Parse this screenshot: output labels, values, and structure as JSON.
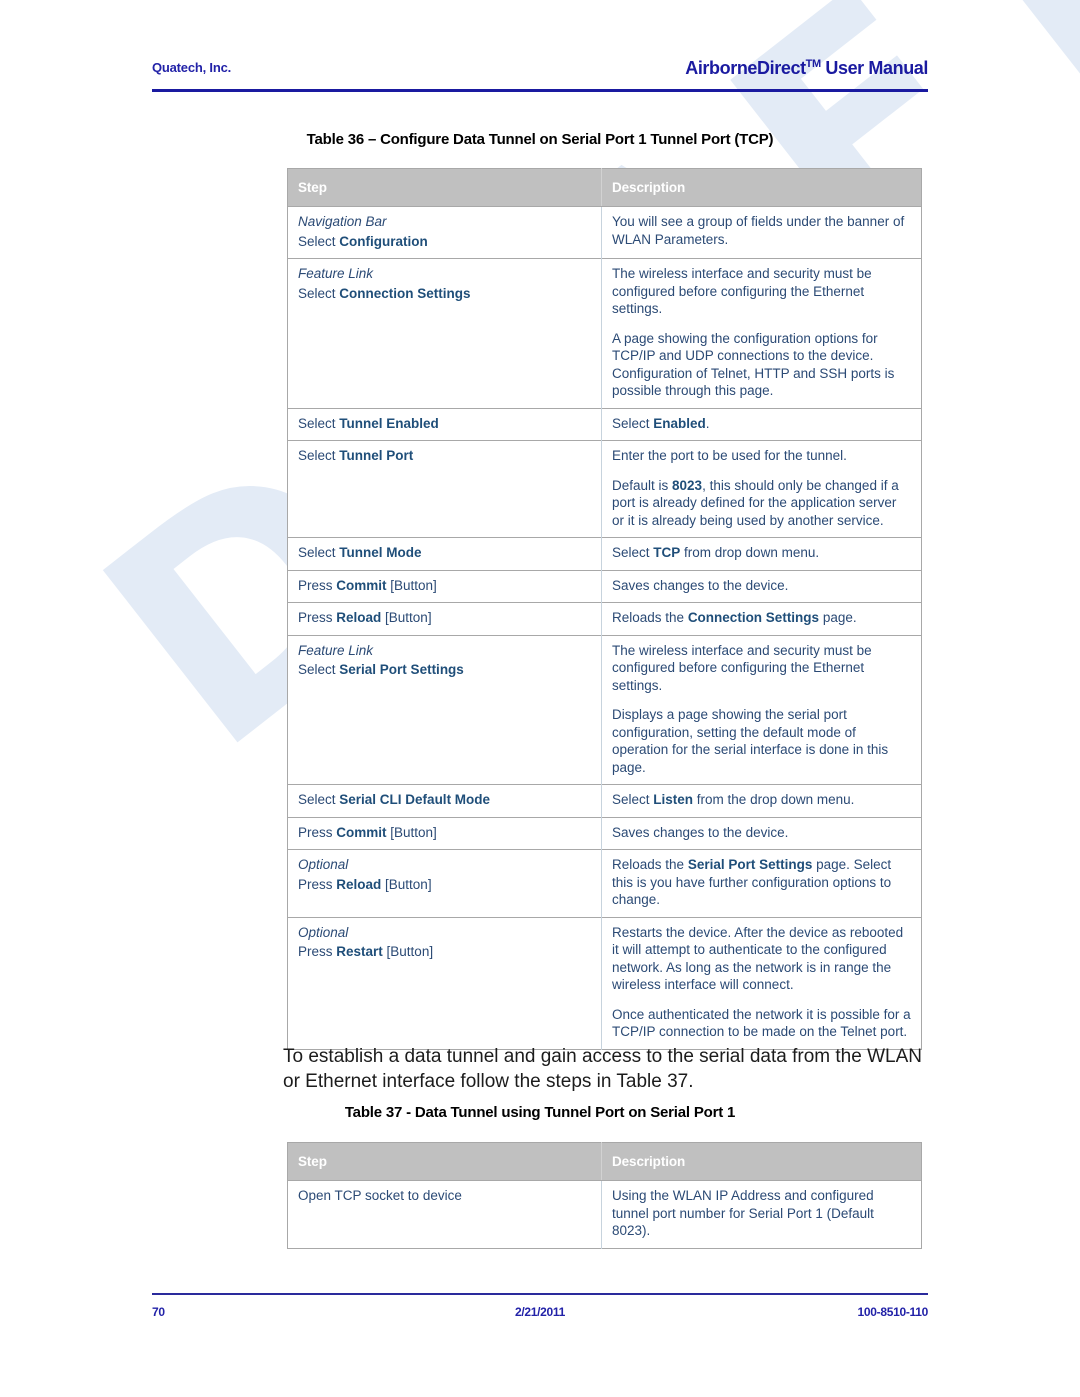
{
  "watermark": {
    "text": "DRAFT",
    "color": "#e3ebf6"
  },
  "header": {
    "left": "Quatech, Inc.",
    "right_main": "AirborneDirect",
    "right_tm": "TM",
    "right_tail": " User Manual",
    "rule_color": "#1a1aa0"
  },
  "table36": {
    "caption": "Table 36 – Configure Data Tunnel on Serial Port 1 Tunnel Port (TCP)",
    "columns": [
      "Step",
      "Description"
    ],
    "rows": [
      {
        "step_italic": "Navigation Bar",
        "step_pre": "Select ",
        "step_bold": "Configuration",
        "step_post": "",
        "desc_paras": [
          {
            "pre": "You will see a group of fields under the banner of WLAN Parameters.",
            "bold": "",
            "post": ""
          }
        ]
      },
      {
        "step_italic": "Feature Link",
        "step_pre": "Select ",
        "step_bold": "Connection Settings",
        "step_post": "",
        "desc_paras": [
          {
            "pre": "The wireless interface and security must be configured before configuring the Ethernet settings.",
            "bold": "",
            "post": ""
          },
          {
            "pre": "A page showing the configuration options for TCP/IP and UDP connections to the device. Configuration of Telnet, HTTP and SSH ports is possible through this page.",
            "bold": "",
            "post": ""
          }
        ]
      },
      {
        "step_italic": "",
        "step_pre": "Select ",
        "step_bold": "Tunnel Enabled",
        "step_post": "",
        "desc_paras": [
          {
            "pre": "Select ",
            "bold": "Enabled",
            "post": "."
          }
        ]
      },
      {
        "step_italic": "",
        "step_pre": "Select ",
        "step_bold": "Tunnel Port",
        "step_post": "",
        "desc_paras": [
          {
            "pre": "Enter the port to be used for the tunnel.",
            "bold": "",
            "post": ""
          },
          {
            "pre": "Default is ",
            "bold": "8023",
            "post": ", this should only be changed if a port is already defined for the application server or it is already being used by another service."
          }
        ]
      },
      {
        "step_italic": "",
        "step_pre": "Select ",
        "step_bold": "Tunnel Mode",
        "step_post": "",
        "desc_paras": [
          {
            "pre": "Select ",
            "bold": "TCP",
            "post": " from drop down menu."
          }
        ]
      },
      {
        "step_italic": "",
        "step_pre": "Press ",
        "step_bold": "Commit",
        "step_post": " [Button]",
        "desc_paras": [
          {
            "pre": "Saves changes to the device.",
            "bold": "",
            "post": ""
          }
        ]
      },
      {
        "step_italic": "",
        "step_pre": "Press ",
        "step_bold": "Reload",
        "step_post": " [Button]",
        "desc_paras": [
          {
            "pre": "Reloads the ",
            "bold": "Connection Settings",
            "post": " page."
          }
        ]
      },
      {
        "step_italic": "Feature Link",
        "step_pre": "Select ",
        "step_bold": "Serial Port Settings",
        "step_post": "",
        "desc_paras": [
          {
            "pre": "The wireless interface and security must be configured before configuring the Ethernet settings.",
            "bold": "",
            "post": ""
          },
          {
            "pre": "Displays a page showing the serial port configuration, setting the default mode of operation for the serial interface is done in this page.",
            "bold": "",
            "post": ""
          }
        ]
      },
      {
        "step_italic": "",
        "step_pre": "Select ",
        "step_bold": "Serial CLI Default Mode",
        "step_post": "",
        "desc_paras": [
          {
            "pre": "Select ",
            "bold": "Listen",
            "post": " from the drop down menu."
          }
        ]
      },
      {
        "step_italic": "",
        "step_pre": "Press ",
        "step_bold": "Commit",
        "step_post": " [Button]",
        "desc_paras": [
          {
            "pre": "Saves changes to the device.",
            "bold": "",
            "post": ""
          }
        ]
      },
      {
        "step_italic": "Optional",
        "step_pre": "Press ",
        "step_bold": "Reload",
        "step_post": " [Button]",
        "desc_paras": [
          {
            "pre": "Reloads the ",
            "bold": "Serial Port Settings",
            "post": " page. Select this is you have further configuration options to change."
          }
        ]
      },
      {
        "step_italic": "Optional",
        "step_pre": "Press ",
        "step_bold": "Restart",
        "step_post": " [Button]",
        "desc_paras": [
          {
            "pre": "Restarts the device. After the device as rebooted it will attempt to authenticate to the configured network. As long as the network is in range the wireless interface will connect.",
            "bold": "",
            "post": ""
          },
          {
            "pre": "Once authenticated the network it is possible for a TCP/IP connection to be made on the Telnet port.",
            "bold": "",
            "post": ""
          }
        ]
      }
    ]
  },
  "body_paragraph": "To establish a data tunnel and gain access to the serial data from the WLAN or Ethernet interface follow the steps in Table 37.",
  "table37": {
    "caption": "Table 37 - Data Tunnel using Tunnel Port on Serial Port 1",
    "columns": [
      "Step",
      "Description"
    ],
    "rows": [
      {
        "step_italic": "",
        "step_pre": "Open TCP socket to device",
        "step_bold": "",
        "step_post": "",
        "desc_paras": [
          {
            "pre": "Using the WLAN IP Address and configured tunnel port number for Serial Port 1 (Default 8023).",
            "bold": "",
            "post": ""
          }
        ]
      }
    ]
  },
  "footer": {
    "page_number": "70",
    "date": "2/21/2011",
    "doc_number": "100-8510-110"
  }
}
